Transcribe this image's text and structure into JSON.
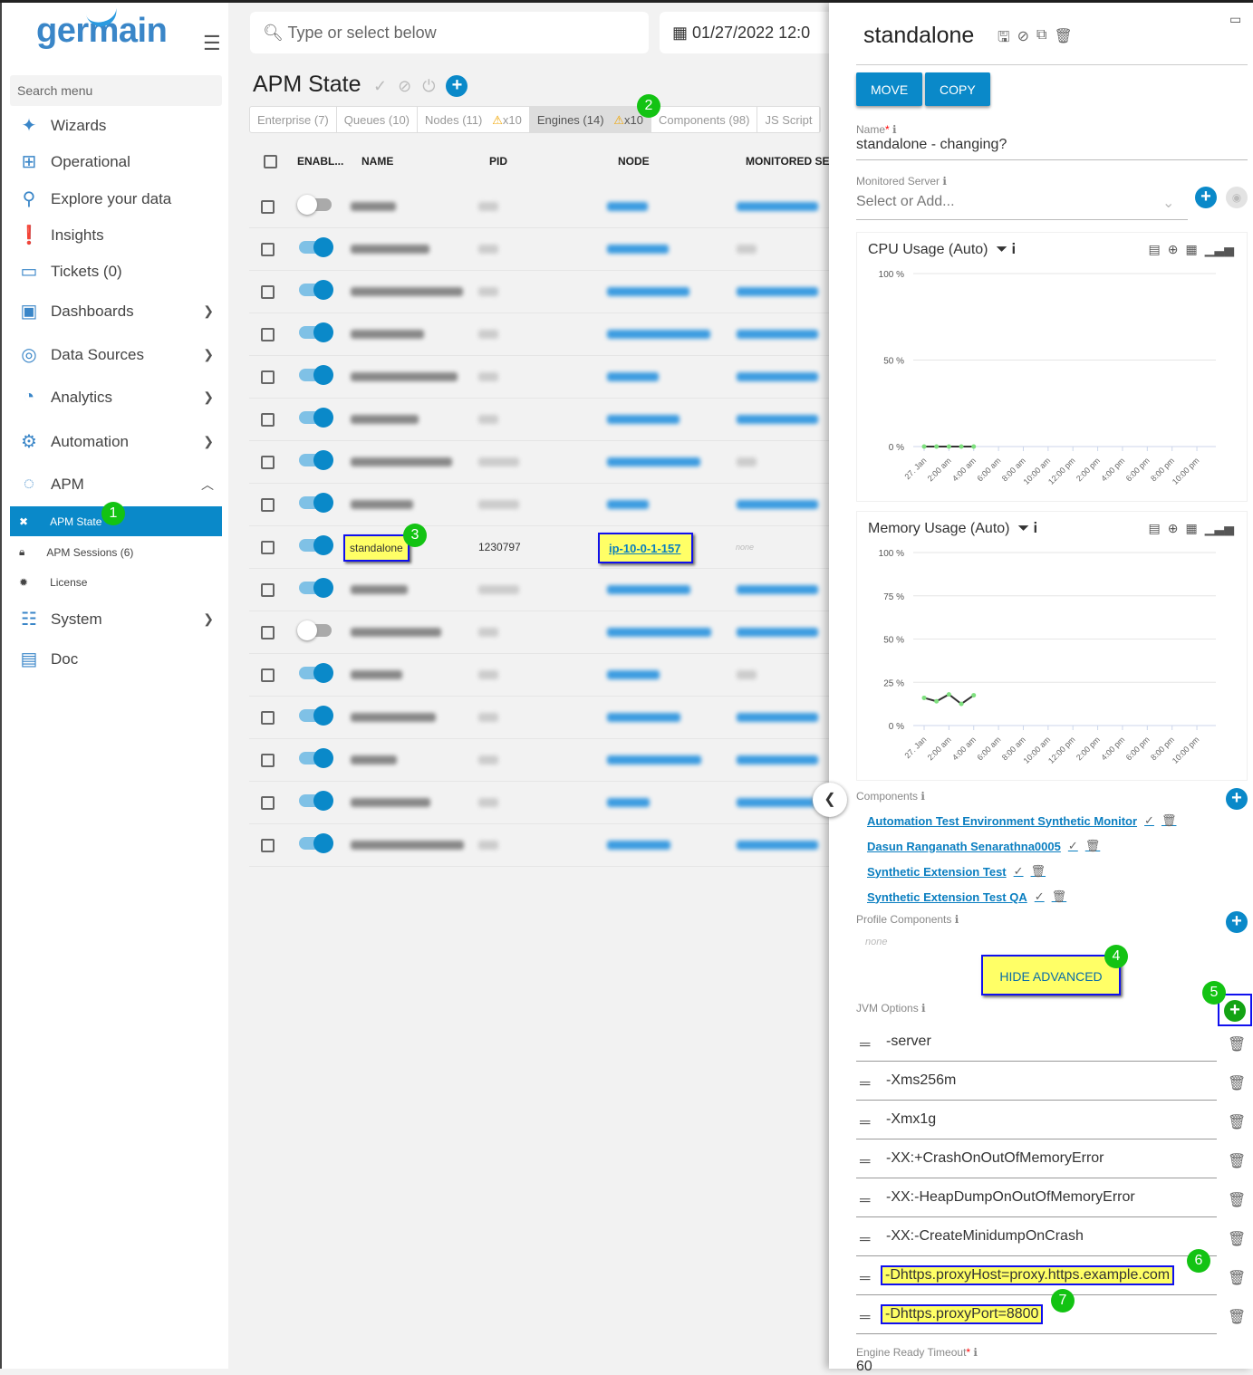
{
  "sidebar": {
    "logo": "germain",
    "search_placeholder": "Search menu",
    "items": [
      {
        "label": "Wizards",
        "icon": "wand-icon"
      },
      {
        "label": "Operational",
        "icon": "sitemap-icon"
      },
      {
        "label": "Explore your data",
        "icon": "search-icon"
      },
      {
        "label": "Insights",
        "icon": "exclamation-icon"
      },
      {
        "label": "Tickets (0)",
        "icon": "ticket-icon"
      },
      {
        "label": "Dashboards",
        "icon": "dashboard-icon"
      },
      {
        "label": "Data Sources",
        "icon": "database-icon"
      },
      {
        "label": "Analytics",
        "icon": "analytics-icon"
      },
      {
        "label": "Automation",
        "icon": "gear-icon"
      },
      {
        "label": "APM",
        "icon": "apm-icon"
      },
      {
        "label": "System",
        "icon": "sliders-icon"
      },
      {
        "label": "Doc",
        "icon": "doc-icon"
      }
    ],
    "apm_sub": [
      {
        "label": "APM State"
      },
      {
        "label": "APM Sessions (6)"
      },
      {
        "label": "License"
      }
    ]
  },
  "header": {
    "search_placeholder": "Type or select below",
    "date": "01/27/2022 12:0"
  },
  "page": {
    "title": "APM State",
    "tabs": [
      {
        "label": "Enterprise (7)"
      },
      {
        "label": "Queues (10)"
      },
      {
        "label": "Nodes (11)",
        "warn": "x10"
      },
      {
        "label": "Engines (14)",
        "warn": "x10",
        "active": true
      },
      {
        "label": "Components (98)"
      },
      {
        "label": "JS Script"
      }
    ],
    "columns": [
      "ENABL...",
      "NAME",
      "PID",
      "NODE",
      "MONITORED SER"
    ],
    "highlight_row": {
      "name": "standalone",
      "pid": "1230797",
      "node": "ip-10-0-1-157",
      "monitored": "none"
    }
  },
  "badges": [
    "1",
    "2",
    "3",
    "4",
    "5",
    "6",
    "7"
  ],
  "panel": {
    "title": "standalone",
    "move": "MOVE",
    "copy": "COPY",
    "name_label": "Name",
    "required": "*",
    "name_value": "standalone - changing?",
    "server_label": "Monitored Server",
    "server_placeholder": "Select or Add...",
    "components_label": "Components",
    "components": [
      "Automation Test Environment Synthetic Monitor",
      "Dasun Ranganath Senarathna0005",
      "Synthetic Extension Test",
      "Synthetic Extension Test QA"
    ],
    "profile_label": "Profile Components",
    "profile_value": "none",
    "hide_advanced": "HIDE ADVANCED",
    "jvm_label": "JVM Options",
    "jvm": [
      "-server",
      "-Xms256m",
      "-Xmx1g",
      "-XX:+CrashOnOutOfMemoryError",
      "-XX:-HeapDumpOnOutOfMemoryError",
      "-XX:-CreateMinidumpOnCrash",
      "-Dhttps.proxyHost=proxy.https.example.com",
      "-Dhttps.proxyPort=8800"
    ],
    "timeout_label": "Engine Ready Timeout",
    "timeout_value": "60"
  },
  "chart_data": [
    {
      "type": "line",
      "title": "CPU Usage (Auto)",
      "yticks": [
        "100 %",
        "50 %",
        "0 %"
      ],
      "ylim": [
        0,
        100
      ],
      "xticks": [
        "27. Jan",
        "2:00 am",
        "4:00 am",
        "6:00 am",
        "8:00 am",
        "10:00 am",
        "12:00 pm",
        "2:00 pm",
        "4:00 pm",
        "6:00 pm",
        "8:00 pm",
        "10:00 pm"
      ],
      "x": [
        "00:00",
        "01:00",
        "02:00",
        "03:00",
        "04:00"
      ],
      "values": [
        0,
        0,
        0,
        0,
        0
      ],
      "color": "#333333",
      "marker_color": "#7ee07e"
    },
    {
      "type": "line",
      "title": "Memory Usage (Auto)",
      "yticks": [
        "100 %",
        "75 %",
        "50 %",
        "25 %",
        "0 %"
      ],
      "ylim": [
        0,
        100
      ],
      "xticks": [
        "27. Jan",
        "2:00 am",
        "4:00 am",
        "6:00 am",
        "8:00 am",
        "10:00 am",
        "12:00 pm",
        "2:00 pm",
        "4:00 pm",
        "6:00 pm",
        "8:00 pm",
        "10:00 pm"
      ],
      "x": [
        "00:00",
        "01:00",
        "02:00",
        "03:00",
        "04:00"
      ],
      "values": [
        16,
        14,
        18,
        12.5,
        17.5
      ],
      "color": "#333333",
      "marker_color": "#7ee07e"
    }
  ]
}
